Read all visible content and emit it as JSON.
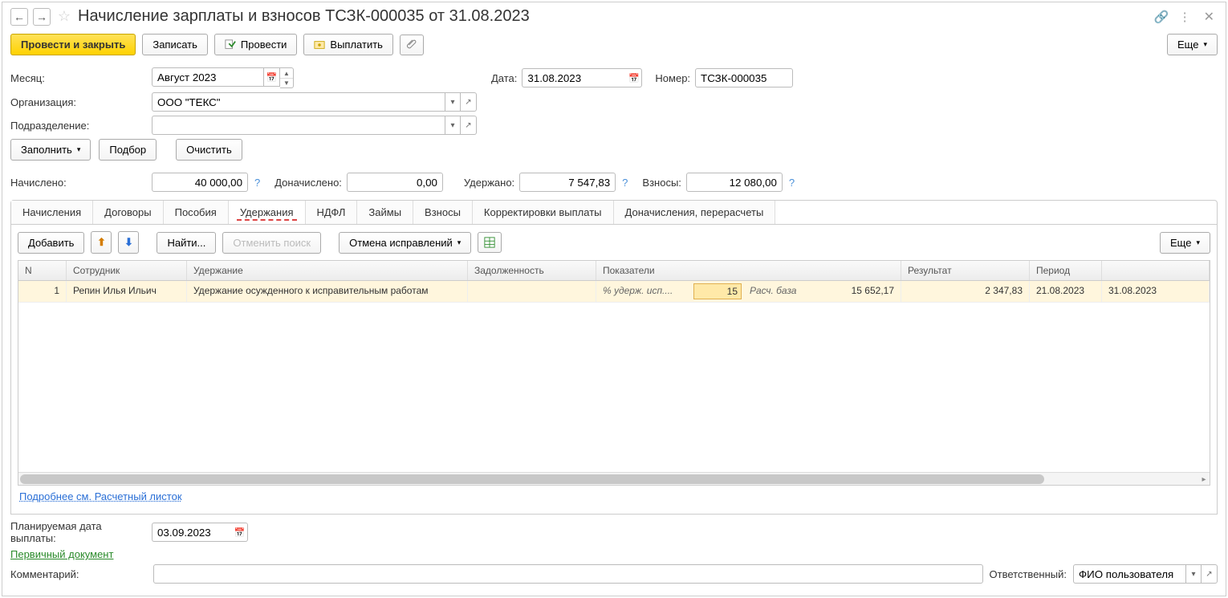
{
  "title": "Начисление зарплаты и взносов ТСЗК-000035 от 31.08.2023",
  "toolbar": {
    "post_close": "Провести и закрыть",
    "save": "Записать",
    "post": "Провести",
    "pay": "Выплатить",
    "more": "Еще"
  },
  "fields": {
    "month_label": "Месяц:",
    "month_value": "Август 2023",
    "date_label": "Дата:",
    "date_value": "31.08.2023",
    "number_label": "Номер:",
    "number_value": "ТСЗК-000035",
    "org_label": "Организация:",
    "org_value": "ООО \"ТЕКС\"",
    "dept_label": "Подразделение:",
    "dept_value": "",
    "planned_label": "Планируемая дата выплаты:",
    "planned_value": "03.09.2023",
    "comment_label": "Комментарий:",
    "comment_value": "",
    "resp_label": "Ответственный:",
    "resp_value": "ФИО пользователя"
  },
  "actions": {
    "fill": "Заполнить",
    "pick": "Подбор",
    "clear": "Очистить"
  },
  "totals": {
    "accrued_label": "Начислено:",
    "accrued_value": "40 000,00",
    "addl_label": "Доначислено:",
    "addl_value": "0,00",
    "withheld_label": "Удержано:",
    "withheld_value": "7 547,83",
    "contrib_label": "Взносы:",
    "contrib_value": "12 080,00"
  },
  "tabs": [
    "Начисления",
    "Договоры",
    "Пособия",
    "Удержания",
    "НДФЛ",
    "Займы",
    "Взносы",
    "Корректировки выплаты",
    "Доначисления, перерасчеты"
  ],
  "active_tab": 3,
  "panel_toolbar": {
    "add": "Добавить",
    "find": "Найти...",
    "cancel_search": "Отменить поиск",
    "cancel_corr": "Отмена исправлений",
    "more": "Еще"
  },
  "grid": {
    "headers": {
      "n": "N",
      "employee": "Сотрудник",
      "deduction": "Удержание",
      "debt": "Задолженность",
      "indicators": "Показатели",
      "result": "Результат",
      "period": "Период"
    },
    "rows": [
      {
        "n": "1",
        "employee": "Репин Илья Ильич",
        "deduction": "Удержание осужденного к исправительным работам",
        "debt": "",
        "ind_label1": "% удерж. исп....",
        "ind_value1": "15",
        "ind_label2": "Расч. база",
        "ind_value2": "15 652,17",
        "result": "2 347,83",
        "period_from": "21.08.2023",
        "period_to": "31.08.2023"
      }
    ]
  },
  "links": {
    "detail": "Подробнее см. Расчетный листок",
    "primary_doc": "Первичный документ"
  }
}
